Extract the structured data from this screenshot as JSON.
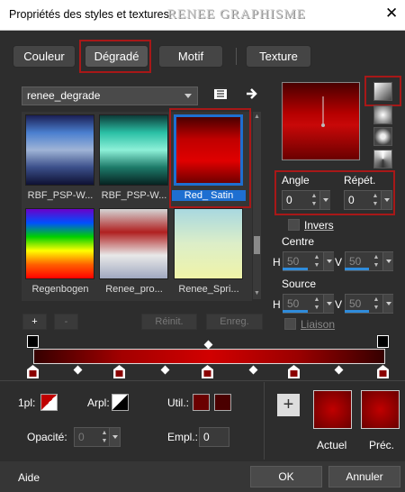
{
  "window": {
    "title": "Propriétés des styles et textures",
    "watermark": "RENEE GRAPHISME",
    "close": "✕"
  },
  "tabs": [
    "Couleur",
    "Dégradé",
    "Motif",
    "Texture"
  ],
  "library": {
    "selected": "renee_degrade"
  },
  "gradients": [
    {
      "label": "RBF_PSP-W...",
      "colors": [
        "#1b1e54",
        "#4a7fcf",
        "#9fb4d6",
        "#3b4f8a",
        "#0e1133"
      ]
    },
    {
      "label": "RBF_PSP-W...",
      "colors": [
        "#0d3b38",
        "#2ac0a5",
        "#8df0d8",
        "#1d7a69",
        "#072321"
      ]
    },
    {
      "label": "Red_ Satin",
      "colors": [
        "#4a0000",
        "#c00000",
        "#e00000",
        "#700000"
      ]
    },
    {
      "label": "Regenbogen",
      "colors": [
        "#6b00c8",
        "#0050ff",
        "#00d000",
        "#ffff00",
        "#ff6000",
        "#ff0000"
      ]
    },
    {
      "label": "Renee_pro...",
      "colors": [
        "#d4d4d4",
        "#b02020",
        "#e8e8e8",
        "#a0a8c0"
      ]
    },
    {
      "label": "Renee_Spri...",
      "colors": [
        "#a8d8e0",
        "#dceec8",
        "#f0f4a8"
      ]
    }
  ],
  "buttons": {
    "add": "+",
    "remove": "-",
    "reset": "Réinit.",
    "save": "Enreg."
  },
  "angle": {
    "label": "Angle",
    "value": "0"
  },
  "repeat": {
    "label": "Répét.",
    "value": "0"
  },
  "invert": {
    "label": "Invers"
  },
  "center": {
    "label": "Centre",
    "h": "50",
    "v": "50"
  },
  "source": {
    "label": "Source",
    "h": "50",
    "v": "50"
  },
  "link": {
    "label": "Liaison"
  },
  "hv": {
    "h": "H",
    "v": "V"
  },
  "bottom": {
    "first": "1pl:",
    "last": "Arpl:",
    "used": "Util.:",
    "opacity": "Opacité:",
    "opacity_value": "0",
    "location": "Empl.:",
    "location_value": "0",
    "plus": "+",
    "current": "Actuel",
    "previous": "Préc."
  },
  "footer": {
    "help": "Aide",
    "ok": "OK",
    "cancel": "Annuler"
  },
  "colors": {
    "accent": "#a81818",
    "selection": "#1e6fd1"
  }
}
